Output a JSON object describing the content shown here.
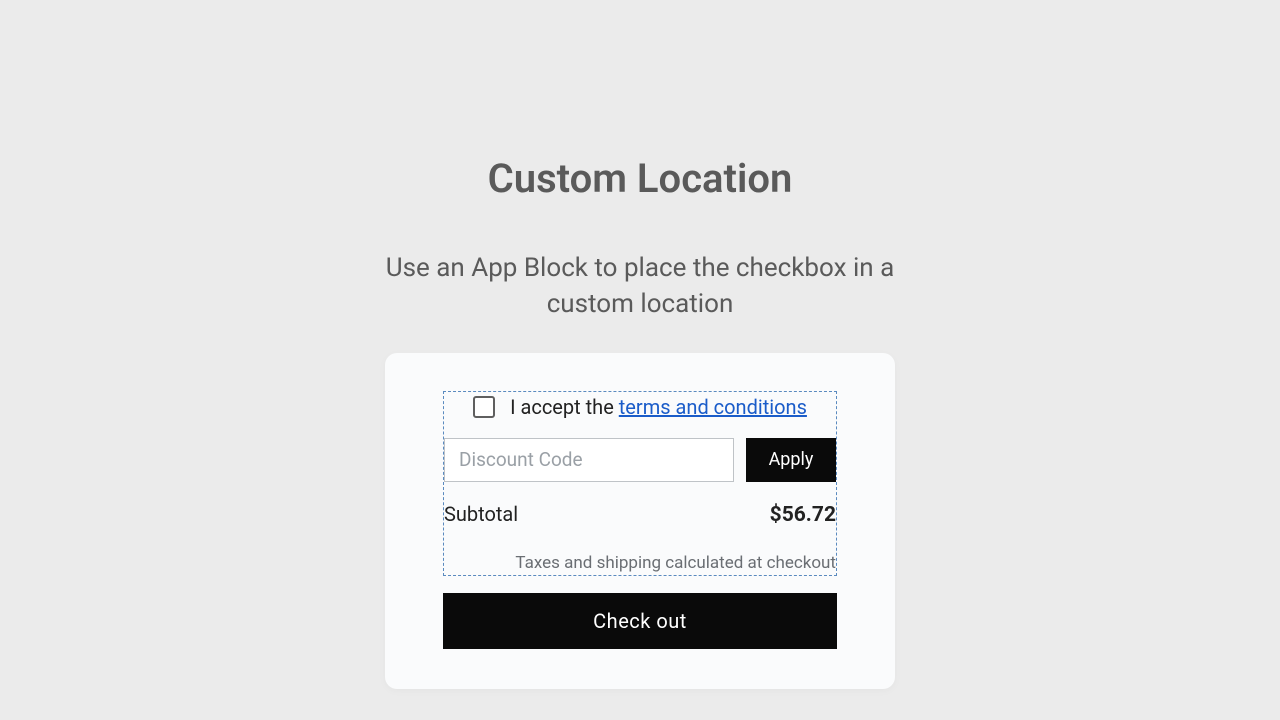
{
  "heading": "Custom Location",
  "subheading": "Use an App Block to place the checkbox in a custom location",
  "consent": {
    "prefix": "I accept the ",
    "link_text": "terms and conditions"
  },
  "discount": {
    "placeholder": "Discount Code",
    "apply_label": "Apply"
  },
  "subtotal": {
    "label": "Subtotal",
    "amount": "$56.72"
  },
  "taxes_note": "Taxes and shipping calculated at checkout",
  "checkout_label": "Check out"
}
